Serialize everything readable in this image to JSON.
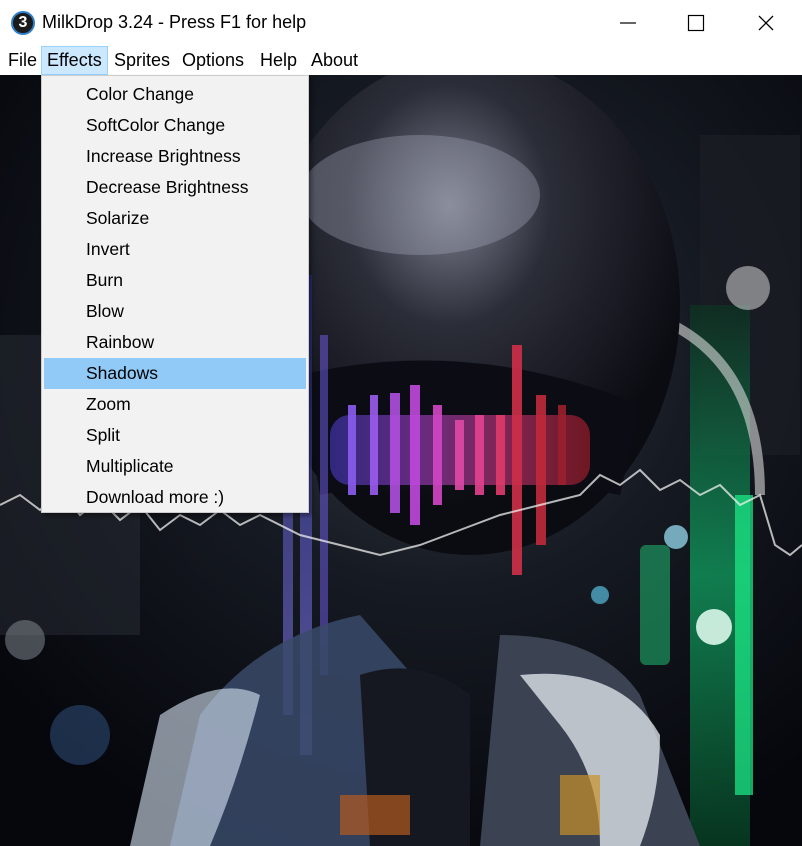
{
  "window": {
    "app_icon_text": "3",
    "title": "MilkDrop 3.24 - Press F1 for help"
  },
  "menubar": {
    "items": [
      "File",
      "Effects",
      "Sprites",
      "Options",
      "Help",
      "About"
    ],
    "active": "Effects"
  },
  "effects_menu": {
    "items": [
      "Color Change",
      "SoftColor Change",
      "Increase Brightness",
      "Decrease Brightness",
      "Solarize",
      "Invert",
      "Burn",
      "Blow",
      "Rainbow",
      "Shadows",
      "Zoom",
      "Split",
      "Multiplicate",
      "Download more :)"
    ],
    "highlighted": "Shadows"
  },
  "colors": {
    "menu_active_bg": "#cce8ff",
    "menu_highlight_bg": "#91c9f7",
    "menu_bg": "#f2f2f2",
    "app_icon_ring": "#2e7ec9"
  },
  "icons": {
    "minimize": "minimize-icon",
    "maximize": "maximize-icon",
    "close": "close-icon"
  }
}
